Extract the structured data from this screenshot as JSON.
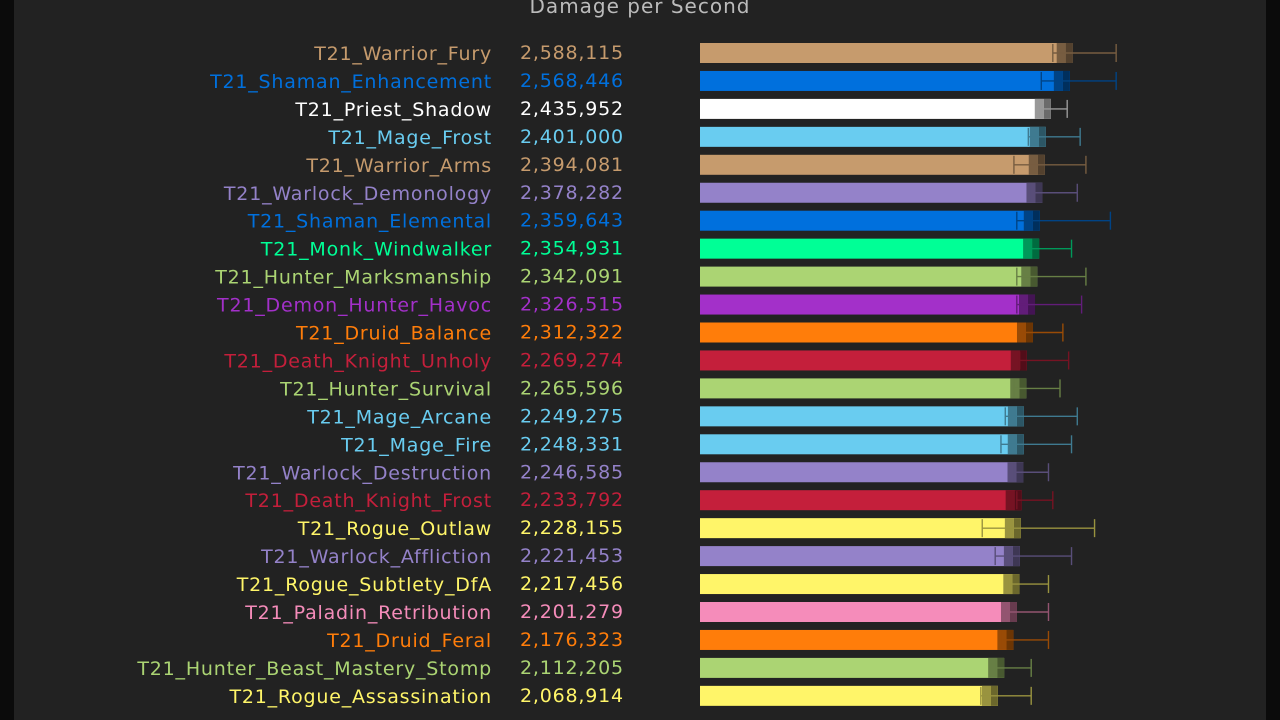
{
  "chart_data": {
    "type": "bar",
    "orientation": "horizontal",
    "title": "Damage per Second",
    "xlim": [
      0,
      3200000
    ],
    "grid": false,
    "bars": [
      {
        "label": "T21_Warrior_Fury",
        "value": 2588115,
        "value_text": "2,588,115",
        "err_low": 2450000,
        "err_high": 2890000,
        "color": "#c69b6d"
      },
      {
        "label": "T21_Shaman_Enhancement",
        "value": 2568446,
        "value_text": "2,568,446",
        "err_low": 2370000,
        "err_high": 2890000,
        "color": "#0070dd"
      },
      {
        "label": "T21_Priest_Shadow",
        "value": 2435952,
        "value_text": "2,435,952",
        "err_low": 2360000,
        "err_high": 2550000,
        "color": "#ffffff"
      },
      {
        "label": "T21_Mage_Frost",
        "value": 2401000,
        "value_text": "2,401,000",
        "err_low": 2280000,
        "err_high": 2640000,
        "color": "#69ccf0"
      },
      {
        "label": "T21_Warrior_Arms",
        "value": 2394081,
        "value_text": "2,394,081",
        "err_low": 2180000,
        "err_high": 2680000,
        "color": "#c69b6d"
      },
      {
        "label": "T21_Warlock_Demonology",
        "value": 2378282,
        "value_text": "2,378,282",
        "err_low": 2290000,
        "err_high": 2620000,
        "color": "#9482c9"
      },
      {
        "label": "T21_Shaman_Elemental",
        "value": 2359643,
        "value_text": "2,359,643",
        "err_low": 2200000,
        "err_high": 2850000,
        "color": "#0070dd"
      },
      {
        "label": "T21_Monk_Windwalker",
        "value": 2354931,
        "value_text": "2,354,931",
        "err_low": 2270000,
        "err_high": 2580000,
        "color": "#00ff96"
      },
      {
        "label": "T21_Hunter_Marksmanship",
        "value": 2342091,
        "value_text": "2,342,091",
        "err_low": 2200000,
        "err_high": 2680000,
        "color": "#abd473"
      },
      {
        "label": "T21_Demon_Hunter_Havoc",
        "value": 2326515,
        "value_text": "2,326,515",
        "err_low": 2200000,
        "err_high": 2650000,
        "color": "#a330c9"
      },
      {
        "label": "T21_Druid_Balance",
        "value": 2312322,
        "value_text": "2,312,322",
        "err_low": 2240000,
        "err_high": 2520000,
        "color": "#ff7d0a"
      },
      {
        "label": "T21_Death_Knight_Unholy",
        "value": 2269274,
        "value_text": "2,269,274",
        "err_low": 2220000,
        "err_high": 2560000,
        "color": "#c41f3b"
      },
      {
        "label": "T21_Hunter_Survival",
        "value": 2265596,
        "value_text": "2,265,596",
        "err_low": 2180000,
        "err_high": 2500000,
        "color": "#abd473"
      },
      {
        "label": "T21_Mage_Arcane",
        "value": 2249275,
        "value_text": "2,249,275",
        "err_low": 2120000,
        "err_high": 2620000,
        "color": "#69ccf0"
      },
      {
        "label": "T21_Mage_Fire",
        "value": 2248331,
        "value_text": "2,248,331",
        "err_low": 2090000,
        "err_high": 2580000,
        "color": "#69ccf0"
      },
      {
        "label": "T21_Warlock_Destruction",
        "value": 2246585,
        "value_text": "2,246,585",
        "err_low": 2180000,
        "err_high": 2420000,
        "color": "#9482c9"
      },
      {
        "label": "T21_Death_Knight_Frost",
        "value": 2233792,
        "value_text": "2,233,792",
        "err_low": 2200000,
        "err_high": 2450000,
        "color": "#c41f3b"
      },
      {
        "label": "T21_Rogue_Outlaw",
        "value": 2228155,
        "value_text": "2,228,155",
        "err_low": 1960000,
        "err_high": 2740000,
        "color": "#fff569"
      },
      {
        "label": "T21_Warlock_Affliction",
        "value": 2221453,
        "value_text": "2,221,453",
        "err_low": 2050000,
        "err_high": 2580000,
        "color": "#9482c9"
      },
      {
        "label": "T21_Rogue_Subtlety_DfA",
        "value": 2217456,
        "value_text": "2,217,456",
        "err_low": 2150000,
        "err_high": 2420000,
        "color": "#fff569"
      },
      {
        "label": "T21_Paladin_Retribution",
        "value": 2201279,
        "value_text": "2,201,279",
        "err_low": 2120000,
        "err_high": 2420000,
        "color": "#f58cba"
      },
      {
        "label": "T21_Druid_Feral",
        "value": 2176323,
        "value_text": "2,176,323",
        "err_low": 2100000,
        "err_high": 2420000,
        "color": "#ff7d0a"
      },
      {
        "label": "T21_Hunter_Beast_Mastery_Stomp",
        "value": 2112205,
        "value_text": "2,112,205",
        "err_low": 2060000,
        "err_high": 2300000,
        "color": "#abd473"
      },
      {
        "label": "T21_Rogue_Assassination",
        "value": 2068914,
        "value_text": "2,068,914",
        "err_low": 1950000,
        "err_high": 2300000,
        "color": "#fff569"
      }
    ]
  }
}
